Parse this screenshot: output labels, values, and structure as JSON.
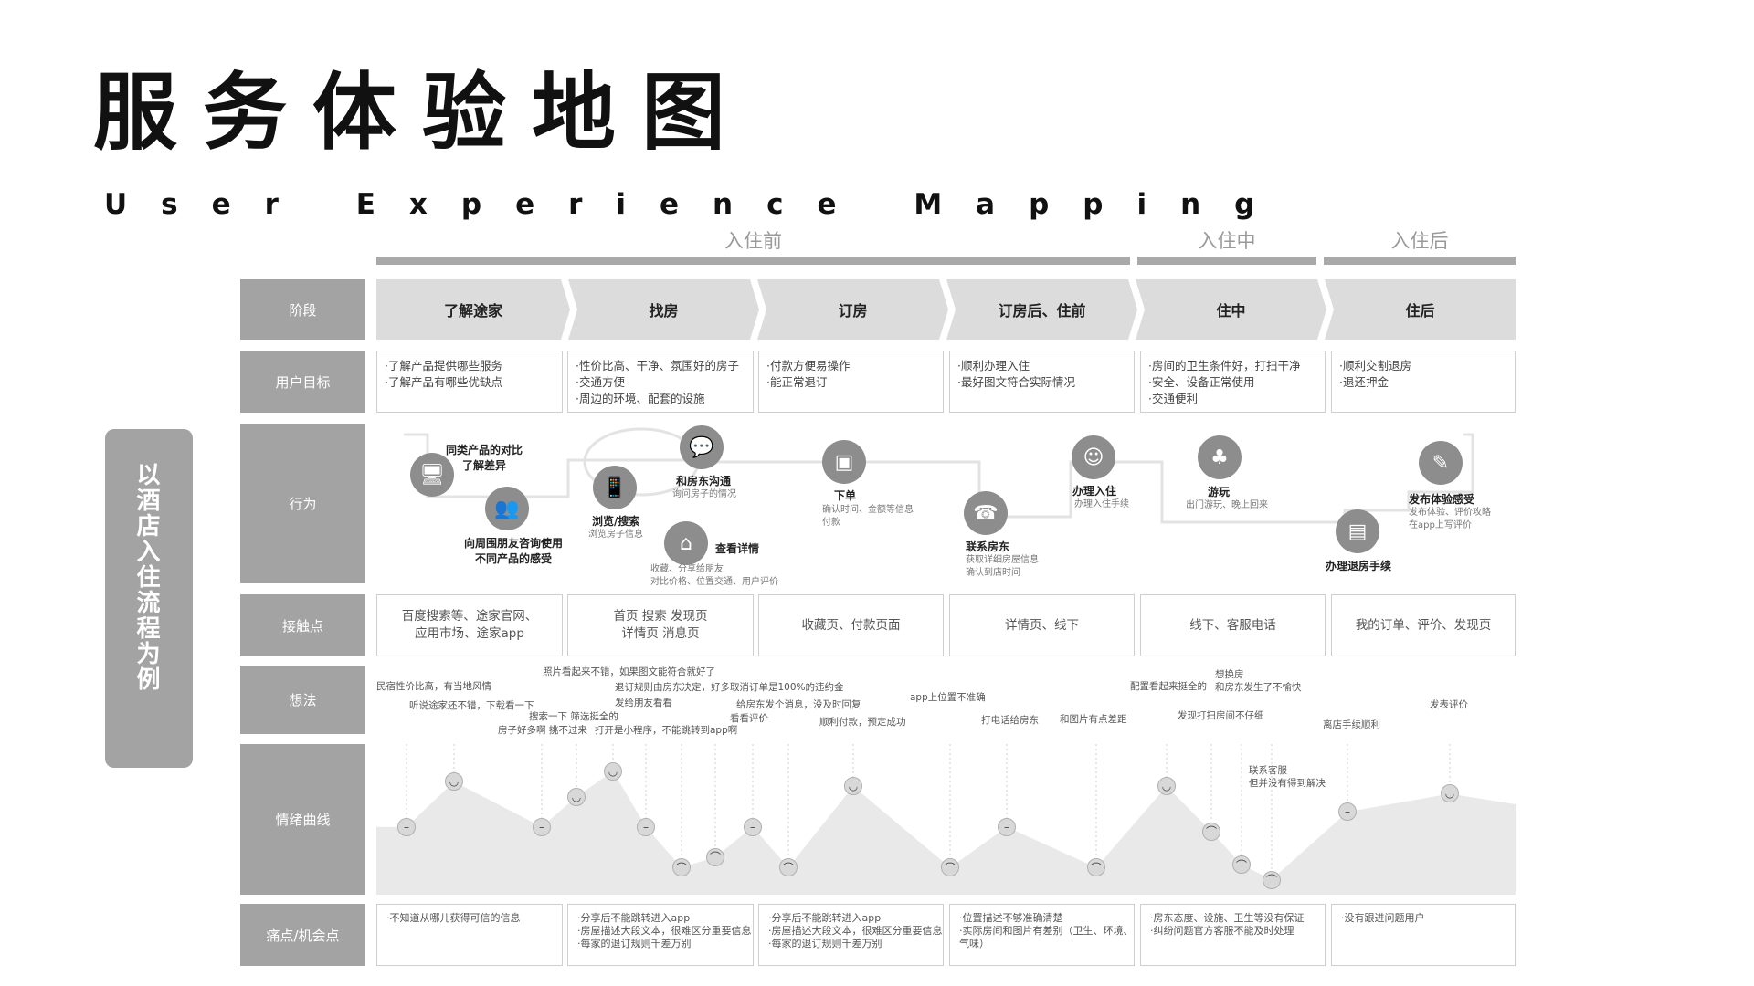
{
  "title": "服务体验地图",
  "subtitle": "User Experience Mapping",
  "phases": [
    "入住前",
    "入住中",
    "入住后"
  ],
  "side_tag": "以酒店入住流程为例",
  "row_labels": [
    "阶段",
    "用户目标",
    "行为",
    "接触点",
    "想法",
    "情绪曲线",
    "痛点/机会点"
  ],
  "stages": [
    "了解途家",
    "找房",
    "订房",
    "订房后、住前",
    "住中",
    "住后"
  ],
  "goals": [
    [
      "·了解产品提供哪些服务",
      "·了解产品有哪些优缺点"
    ],
    [
      "·性价比高、干净、氛围好的房子",
      "·交通方便",
      "·周边的环境、配套的设施"
    ],
    [
      "·付款方便易操作",
      "·能正常退订"
    ],
    [
      "·顺利办理入住",
      "·最好图文符合实际情况"
    ],
    [
      "·房间的卫生条件好，打扫干净",
      "·安全、设备正常使用",
      "·交通便利"
    ],
    [
      "·顺利交割退房",
      "·退还押金"
    ]
  ],
  "actions": [
    {
      "icon": "computer-icon",
      "symbol": "🖥",
      "title": [
        "同类产品的对比",
        "了解差异"
      ],
      "desc": []
    },
    {
      "icon": "people-icon",
      "symbol": "👥",
      "title": [
        "向周围朋友咨询使用",
        "不同产品的感受"
      ],
      "desc": []
    },
    {
      "icon": "phone-icon",
      "symbol": "📱",
      "title": [
        "浏览/搜索"
      ],
      "desc": [
        "浏览房子信息"
      ]
    },
    {
      "icon": "chat-icon",
      "symbol": "💬",
      "title": [
        "和房东沟通"
      ],
      "desc": [
        "询问房子的情况"
      ]
    },
    {
      "icon": "home-icon",
      "symbol": "⌂",
      "title": [
        "查看详情"
      ],
      "desc": [
        "收藏、分享给朋友",
        "对比价格、位置交通、用户评价"
      ]
    },
    {
      "icon": "wallet-icon",
      "symbol": "▣",
      "title": [
        "下单"
      ],
      "desc": [
        "确认时间、金额等信息",
        "付款"
      ]
    },
    {
      "icon": "telephone-icon",
      "symbol": "☎",
      "title": [
        "联系房东"
      ],
      "desc": [
        "获取详细房屋信息",
        "确认到店时间"
      ]
    },
    {
      "icon": "checkin-icon",
      "symbol": "☺",
      "title": [
        "办理入住"
      ],
      "desc": [
        "办理入住手续"
      ]
    },
    {
      "icon": "palm-tree-icon",
      "symbol": "♣",
      "title": [
        "游玩"
      ],
      "desc": [
        "出门游玩、晚上回来"
      ]
    },
    {
      "icon": "luggage-icon",
      "symbol": "▤",
      "title": [
        "办理退房手续"
      ],
      "desc": []
    },
    {
      "icon": "edit-icon",
      "symbol": "✎",
      "title": [
        "发布体验感受"
      ],
      "desc": [
        "发布体验、评价攻略",
        "在app上写评价"
      ]
    }
  ],
  "touchpoints": [
    [
      "百度搜索等、途家官网、",
      "应用市场、途家app"
    ],
    [
      "首页 搜索 发现页",
      "详情页 消息页"
    ],
    [
      "收藏页、付款页面"
    ],
    [
      "详情页、线下"
    ],
    [
      "线下、客服电话"
    ],
    [
      "我的订单、评价、发现页"
    ]
  ],
  "thoughts": [
    "民宿性价比高，有当地风情",
    "听说途家还不错，下载看一下",
    "房子好多啊 挑不过来",
    "搜索一下 筛选挺全的",
    "照片看起来不错，如果图文能符合就好了",
    "退订规则由房东决定，好多取消订单是100%的违约金",
    "发给朋友看看",
    "打开是小程序，不能跳转到app啊",
    "给房东发个消息，没及时回复",
    "看看评价",
    "顺利付款，预定成功",
    "app上位置不准确",
    "打电话给房东",
    "和图片有点差距",
    "配置看起来挺全的",
    "想换房",
    "和房东发生了不愉快",
    "发现打扫房间不仔细",
    "联系客服",
    "但并没有得到解决",
    "离店手续顺利",
    "发表评价"
  ],
  "emotion_points": [
    {
      "face": "neutral",
      "level": 0.45
    },
    {
      "face": "happy",
      "level": 0.75
    },
    {
      "face": "neutral",
      "level": 0.45
    },
    {
      "face": "happy",
      "level": 0.65
    },
    {
      "face": "happy",
      "level": 0.82
    },
    {
      "face": "neutral",
      "level": 0.45
    },
    {
      "face": "sad",
      "level": 0.18
    },
    {
      "face": "sad",
      "level": 0.25
    },
    {
      "face": "neutral",
      "level": 0.45
    },
    {
      "face": "sad",
      "level": 0.18
    },
    {
      "face": "happy",
      "level": 0.72
    },
    {
      "face": "sad",
      "level": 0.18
    },
    {
      "face": "neutral",
      "level": 0.45
    },
    {
      "face": "sad",
      "level": 0.18
    },
    {
      "face": "happy",
      "level": 0.72
    },
    {
      "face": "sad",
      "level": 0.42
    },
    {
      "face": "sad",
      "level": 0.2
    },
    {
      "face": "sad",
      "level": 0.1
    },
    {
      "face": "neutral",
      "level": 0.55
    },
    {
      "face": "happy",
      "level": 0.67
    }
  ],
  "pain_points": [
    [
      "·不知道从哪儿获得可信的信息"
    ],
    [
      "·分享后不能跳转进入app",
      "·房屋描述大段文本，很难区分重要信息",
      "·每家的退订规则千差万别"
    ],
    [
      "·分享后不能跳转进入app",
      "·房屋描述大段文本，很难区分重要信息",
      "·每家的退订规则千差万别"
    ],
    [
      "·位置描述不够准确清楚",
      "·实际房间和图片有差别（卫生、环境、",
      "气味）"
    ],
    [
      "·房东态度、设施、卫生等没有保证",
      "·纠纷问题官方客服不能及时处理"
    ],
    [
      "·没有跟进问题用户"
    ]
  ]
}
